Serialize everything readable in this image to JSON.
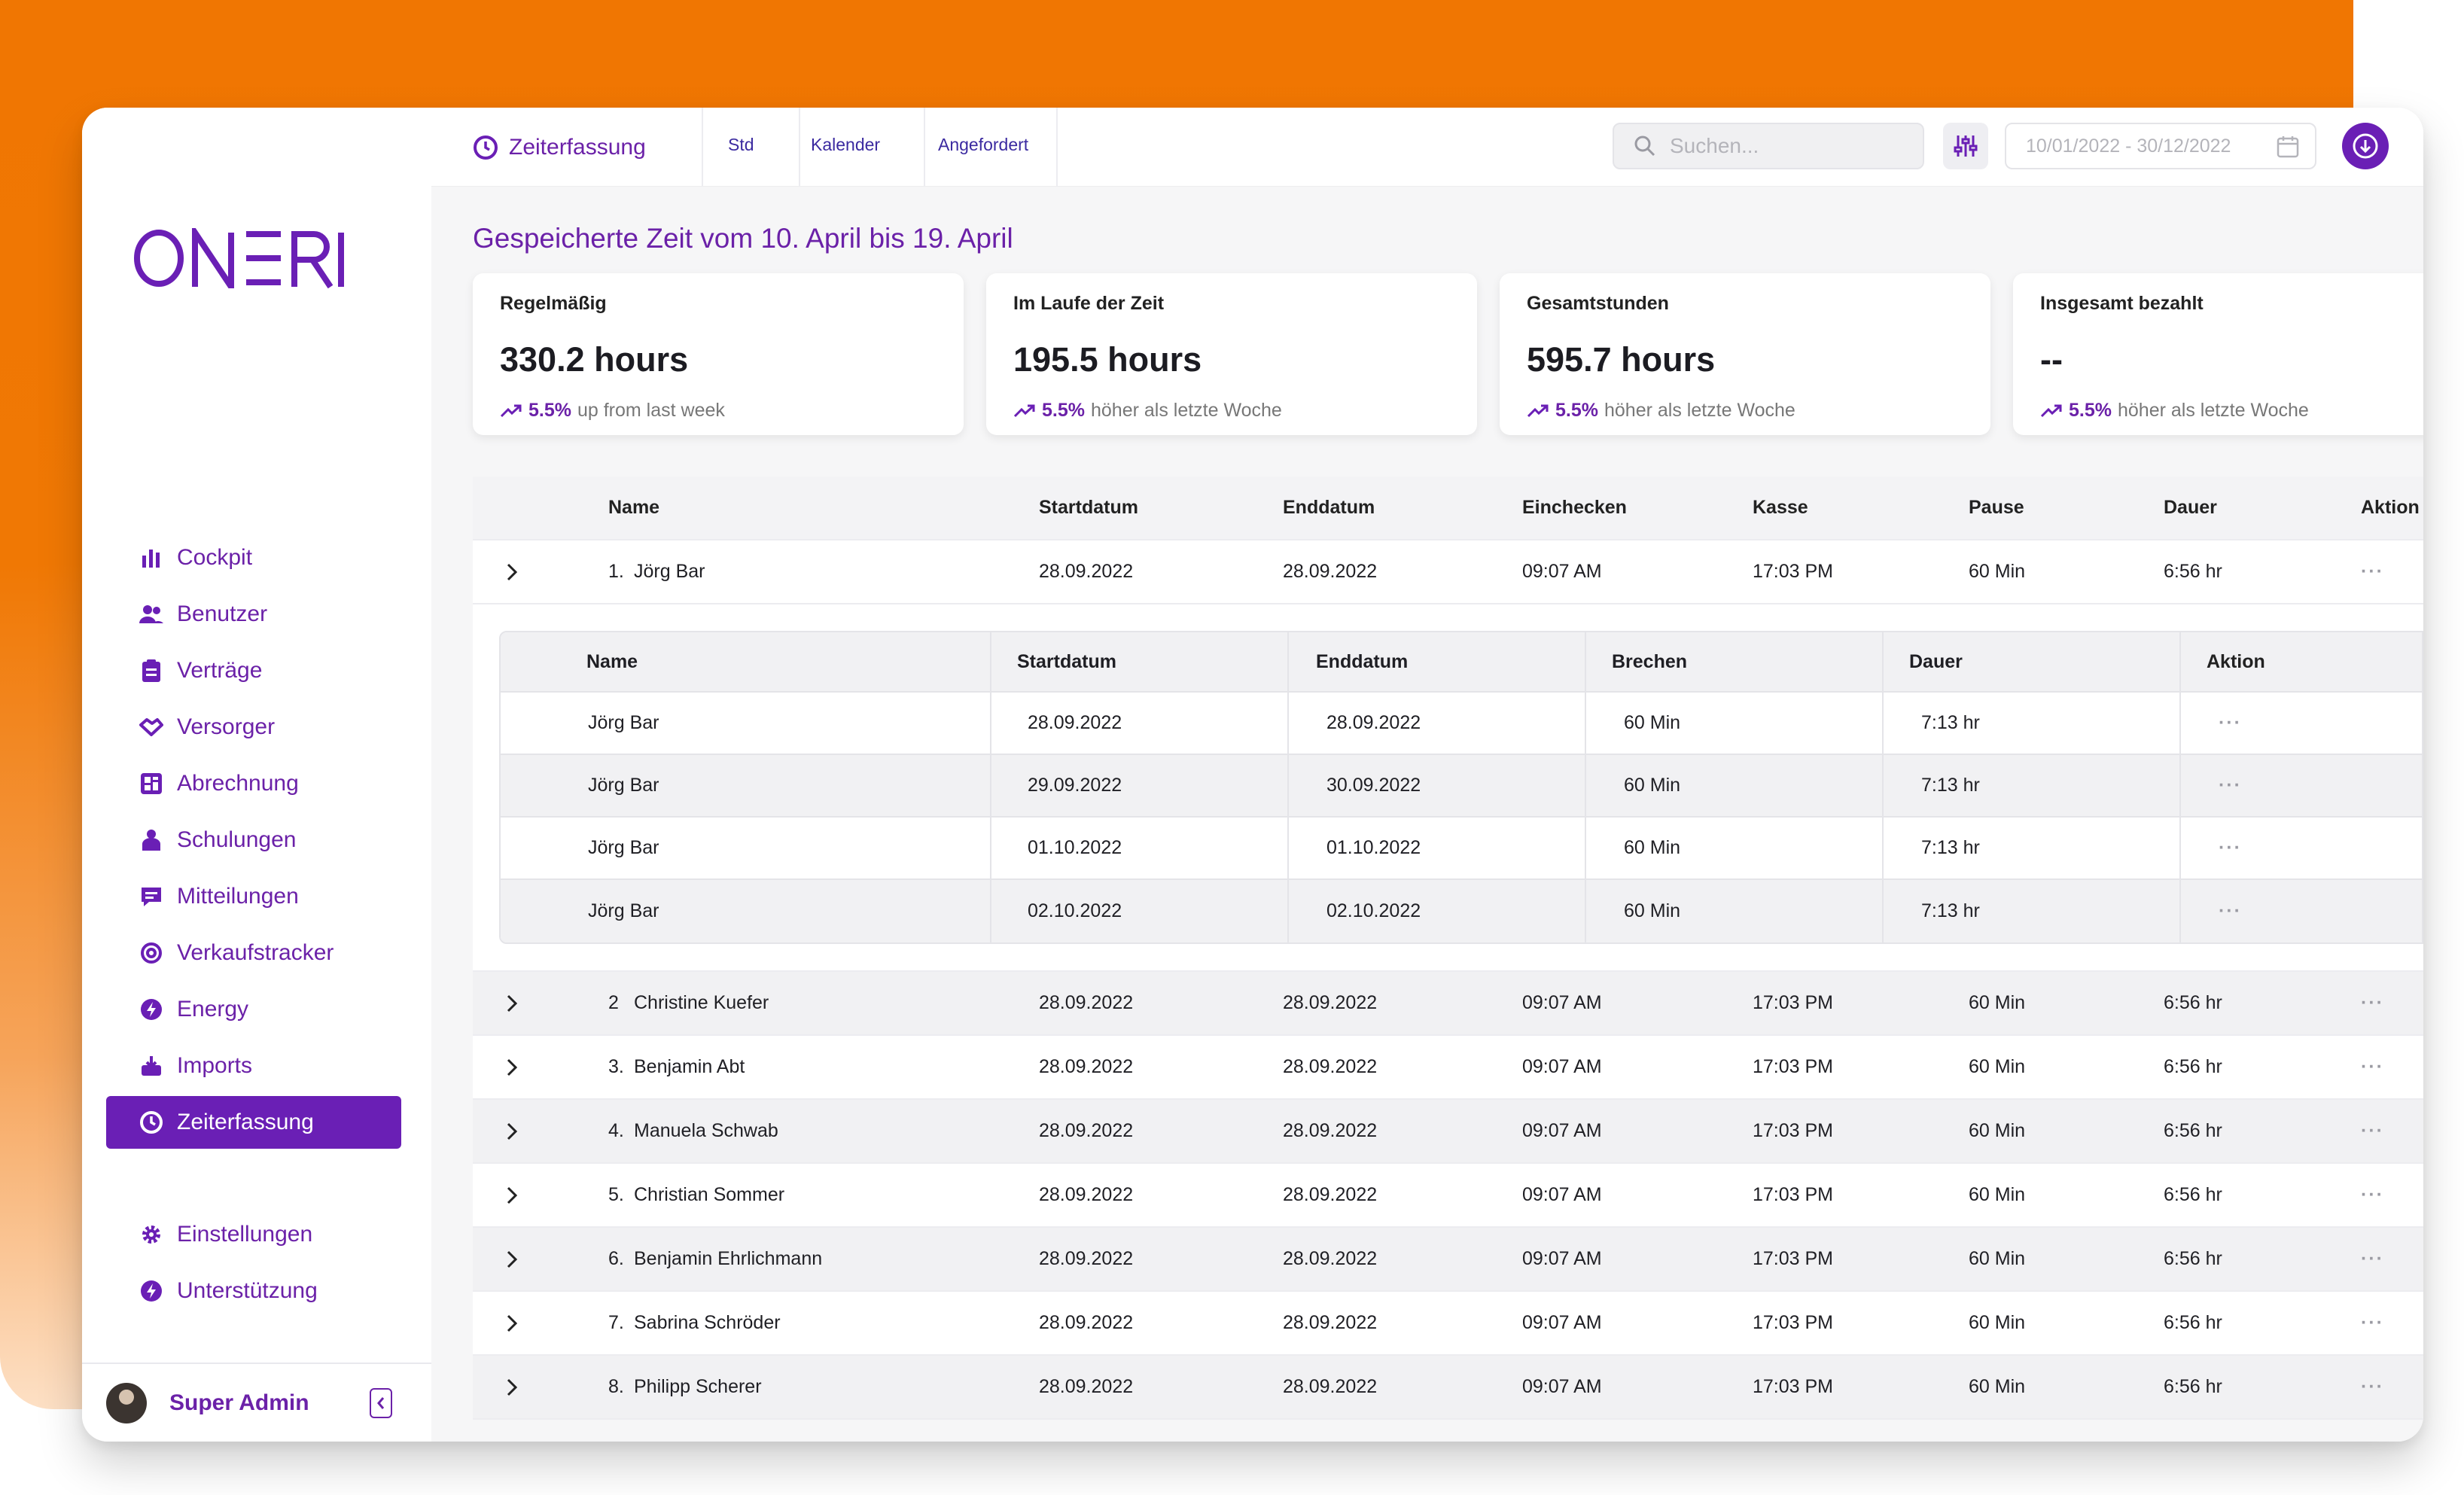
{
  "brand": {
    "logo_text": "ONERI",
    "color": "#6a1fb5",
    "accent": "#f07602"
  },
  "sidebar": {
    "items": [
      {
        "label": "Cockpit",
        "icon": "bar-chart-icon"
      },
      {
        "label": "Benutzer",
        "icon": "users-icon"
      },
      {
        "label": "Verträge",
        "icon": "clipboard-icon"
      },
      {
        "label": "Versorger",
        "icon": "handshake-icon"
      },
      {
        "label": "Abrechnung",
        "icon": "dashboard-grid-icon"
      },
      {
        "label": "Schulungen",
        "icon": "teacher-icon"
      },
      {
        "label": "Mitteilungen",
        "icon": "message-icon"
      },
      {
        "label": "Verkaufstracker",
        "icon": "target-icon"
      },
      {
        "label": "Energy",
        "icon": "bolt-icon"
      },
      {
        "label": "Imports",
        "icon": "import-icon"
      },
      {
        "label": "Zeiterfassung",
        "icon": "clock-icon",
        "active": true
      }
    ],
    "bottom_items": [
      {
        "label": "Einstellungen",
        "icon": "gear-icon"
      },
      {
        "label": "Unterstützung",
        "icon": "support-bolt-icon"
      }
    ],
    "user": {
      "name": "Super Admin"
    }
  },
  "topbar": {
    "title": "Zeiterfassung",
    "tabs": [
      "Std",
      "Kalender",
      "Angefordert"
    ],
    "search_placeholder": "Suchen...",
    "date_range": "10/01/2022 - 30/12/2022"
  },
  "main": {
    "heading": "Gespeicherte Zeit vom 10. April bis 19. April",
    "cards": [
      {
        "label": "Regelmäßig",
        "value": "330.2 hours",
        "pct": "5.5%",
        "trend": "up from last week"
      },
      {
        "label": "Im Laufe der Zeit",
        "value": "195.5 hours",
        "pct": "5.5%",
        "trend": "höher als letzte Woche"
      },
      {
        "label": "Gesamtstunden",
        "value": "595.7 hours",
        "pct": "5.5%",
        "trend": "höher als letzte Woche"
      },
      {
        "label": "Insgesamt bezahlt",
        "value": "--",
        "pct": "5.5%",
        "trend": "höher als letzte Woche"
      }
    ],
    "table": {
      "headers": [
        "Name",
        "Startdatum",
        "Enddatum",
        "Einchecken",
        "Kasse",
        "Pause",
        "Dauer",
        "Aktion"
      ],
      "rows": [
        {
          "num": "1.",
          "name": "Jörg Bar",
          "start": "28.09.2022",
          "end": "28.09.2022",
          "in": "09:07 AM",
          "out": "17:03 PM",
          "pause": "60 Min",
          "dur": "6:56 hr",
          "action": "···"
        },
        {
          "num": "2",
          "name": "Christine Kuefer",
          "start": "28.09.2022",
          "end": "28.09.2022",
          "in": "09:07 AM",
          "out": "17:03 PM",
          "pause": "60 Min",
          "dur": "6:56 hr",
          "action": "···"
        },
        {
          "num": "3.",
          "name": "Benjamin Abt",
          "start": "28.09.2022",
          "end": "28.09.2022",
          "in": "09:07 AM",
          "out": "17:03 PM",
          "pause": "60 Min",
          "dur": "6:56 hr",
          "action": "···"
        },
        {
          "num": "4.",
          "name": "Manuela Schwab",
          "start": "28.09.2022",
          "end": "28.09.2022",
          "in": "09:07 AM",
          "out": "17:03 PM",
          "pause": "60 Min",
          "dur": "6:56 hr",
          "action": "···"
        },
        {
          "num": "5.",
          "name": "Christian Sommer",
          "start": "28.09.2022",
          "end": "28.09.2022",
          "in": "09:07 AM",
          "out": "17:03 PM",
          "pause": "60 Min",
          "dur": "6:56 hr",
          "action": "···"
        },
        {
          "num": "6.",
          "name": "Benjamin Ehrlichmann",
          "start": "28.09.2022",
          "end": "28.09.2022",
          "in": "09:07 AM",
          "out": "17:03 PM",
          "pause": "60 Min",
          "dur": "6:56 hr",
          "action": "···"
        },
        {
          "num": "7.",
          "name": "Sabrina Schröder",
          "start": "28.09.2022",
          "end": "28.09.2022",
          "in": "09:07 AM",
          "out": "17:03 PM",
          "pause": "60 Min",
          "dur": "6:56 hr",
          "action": "···"
        },
        {
          "num": "8.",
          "name": "Philipp Scherer",
          "start": "28.09.2022",
          "end": "28.09.2022",
          "in": "09:07 AM",
          "out": "17:03 PM",
          "pause": "60 Min",
          "dur": "6:56 hr",
          "action": "···"
        }
      ],
      "expanded": {
        "headers": [
          "Name",
          "Startdatum",
          "Enddatum",
          "Brechen",
          "Dauer",
          "Aktion"
        ],
        "rows": [
          {
            "name": "Jörg Bar",
            "start": "28.09.2022",
            "end": "28.09.2022",
            "break": "60 Min",
            "dur": "7:13 hr",
            "action": "···"
          },
          {
            "name": "Jörg Bar",
            "start": "29.09.2022",
            "end": "30.09.2022",
            "break": "60 Min",
            "dur": "7:13 hr",
            "action": "···"
          },
          {
            "name": "Jörg Bar",
            "start": "01.10.2022",
            "end": "01.10.2022",
            "break": "60 Min",
            "dur": "7:13 hr",
            "action": "···"
          },
          {
            "name": "Jörg Bar",
            "start": "02.10.2022",
            "end": "02.10.2022",
            "break": "60 Min",
            "dur": "7:13 hr",
            "action": "···"
          }
        ]
      }
    }
  }
}
